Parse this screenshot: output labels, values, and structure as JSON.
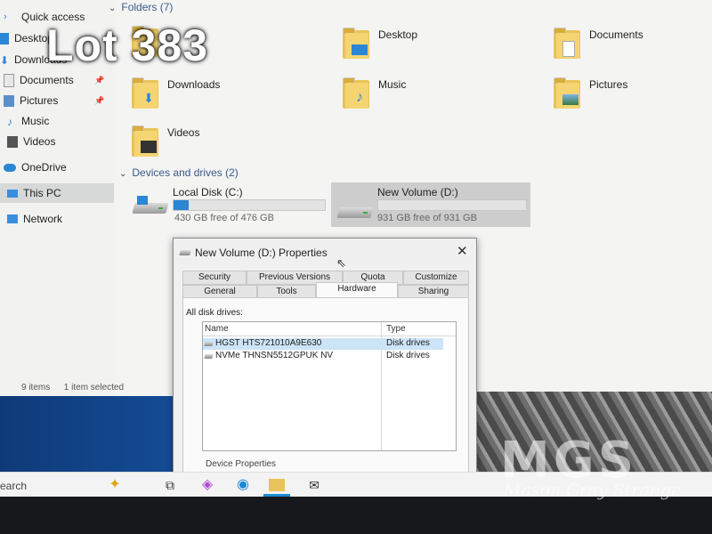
{
  "overlay": {
    "lot_label": "Lot 383"
  },
  "sidebar": {
    "items": [
      {
        "label": "Quick access",
        "icon": "star-icon"
      },
      {
        "label": "Desktop",
        "icon": "desktop-icon"
      },
      {
        "label": "Downloads",
        "icon": "download-icon"
      },
      {
        "label": "Documents",
        "icon": "documents-icon"
      },
      {
        "label": "Pictures",
        "icon": "pictures-icon"
      },
      {
        "label": "Music",
        "icon": "music-icon"
      },
      {
        "label": "Videos",
        "icon": "videos-icon"
      },
      {
        "label": "OneDrive",
        "icon": "cloud-icon"
      },
      {
        "label": "This PC",
        "icon": "computer-icon"
      },
      {
        "label": "Network",
        "icon": "network-icon"
      }
    ]
  },
  "folders": {
    "header": "Folders (7)",
    "items": [
      {
        "label": "Desktop",
        "icon": "desktop-folder-icon"
      },
      {
        "label": "Documents",
        "icon": "documents-folder-icon"
      },
      {
        "label": "Downloads",
        "icon": "downloads-folder-icon"
      },
      {
        "label": "Music",
        "icon": "music-folder-icon"
      },
      {
        "label": "Pictures",
        "icon": "pictures-folder-icon"
      },
      {
        "label": "Videos",
        "icon": "videos-folder-icon"
      }
    ]
  },
  "drives": {
    "header": "Devices and drives (2)",
    "items": [
      {
        "label": "Local Disk (C:)",
        "free": "430 GB free of 476 GB",
        "used_fraction": 0.1
      },
      {
        "label": "New Volume (D:)",
        "free": "931 GB free of 931 GB",
        "used_fraction": 0.0
      }
    ]
  },
  "statusbar": {
    "items": "9 items",
    "selected": "1 item selected"
  },
  "dialog": {
    "title": "New Volume (D:) Properties",
    "close": "✕",
    "tabs_row1": [
      "Security",
      "Previous Versions",
      "Quota",
      "Customize"
    ],
    "tabs_row2": [
      "General",
      "Tools",
      "Hardware",
      "Sharing"
    ],
    "active_tab": "Hardware",
    "all_disk_drives_label": "All disk drives:",
    "columns": {
      "name": "Name",
      "type": "Type"
    },
    "rows": [
      {
        "name": "HGST HTS721010A9E630",
        "type": "Disk drives"
      },
      {
        "name": "NVMe THNSN5512GPUK NV",
        "type": "Disk drives"
      }
    ],
    "device_properties": "Device Properties"
  },
  "taskbar": {
    "search": "earch"
  },
  "watermark": {
    "logo": "MGS",
    "text": "Mason Gray Strange"
  },
  "colors": {
    "accent": "#2b86d6",
    "selection": "#cce4f7",
    "folder": "#f4d572"
  }
}
